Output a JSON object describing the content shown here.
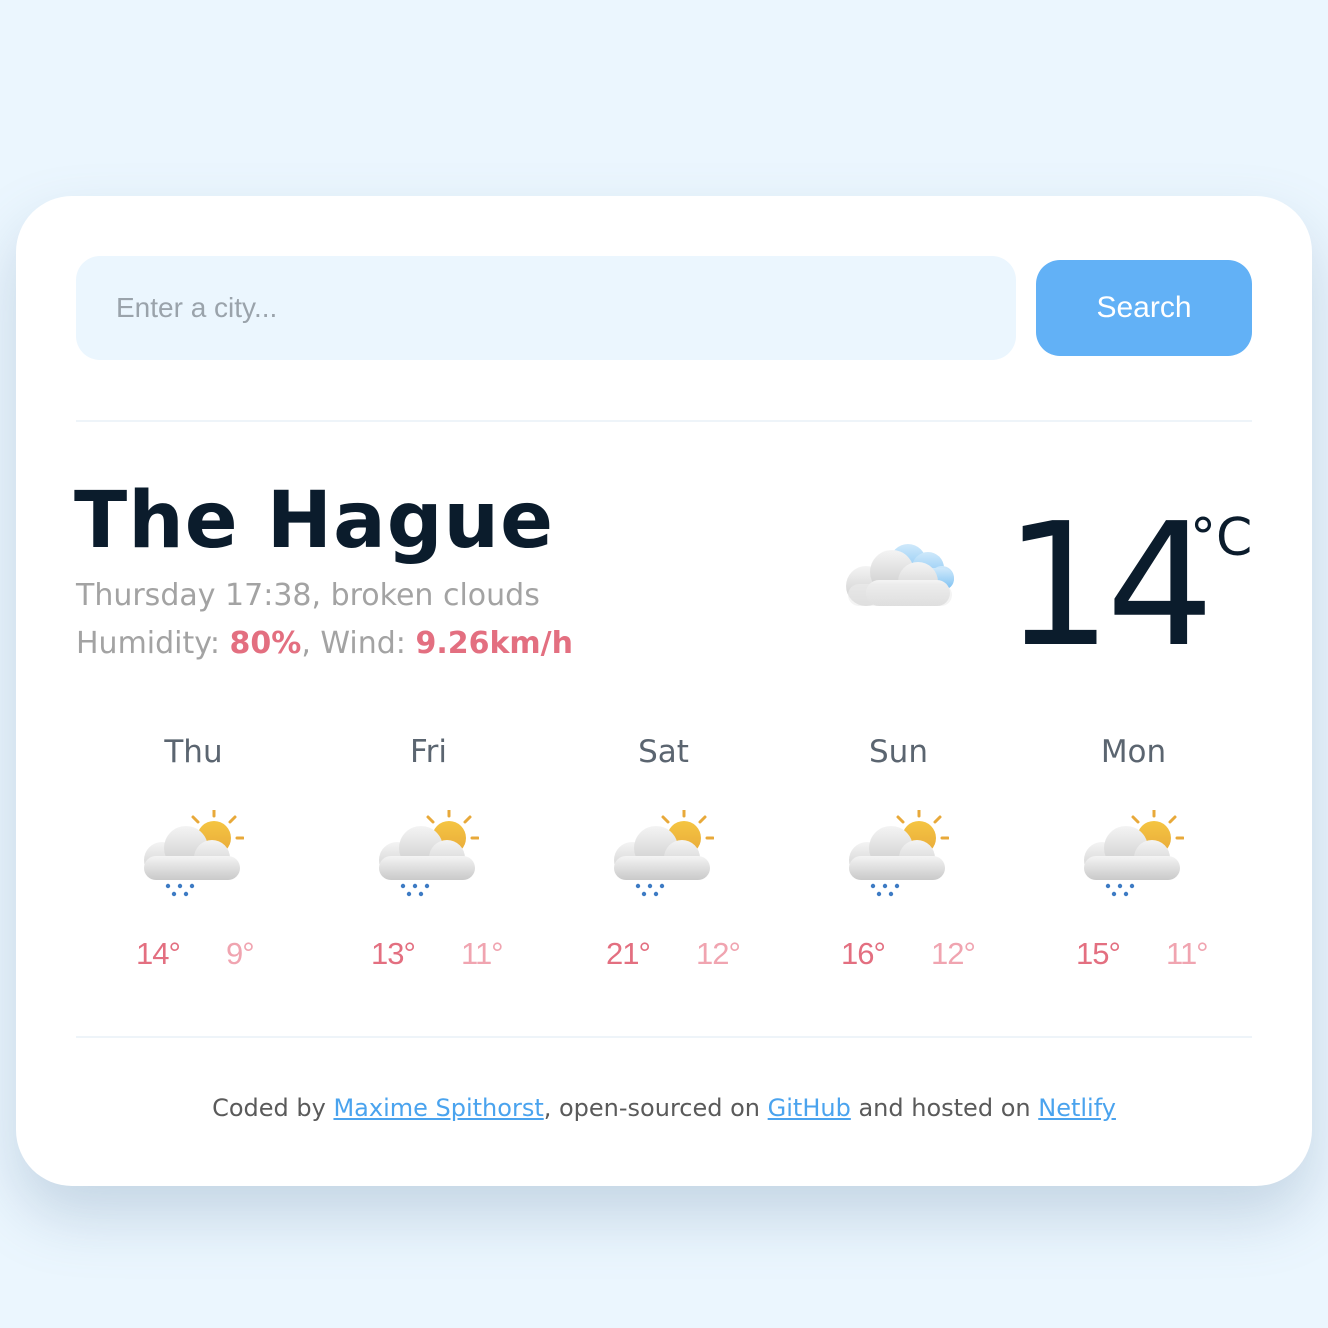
{
  "search": {
    "placeholder": "Enter a city...",
    "button_label": "Search"
  },
  "current": {
    "city": "The Hague",
    "day_time": "Thursday 17:38",
    "description": "broken clouds",
    "humidity_label": "Humidity:",
    "humidity_value": "80%",
    "wind_label": "Wind:",
    "wind_value": "9.26km/h",
    "temperature": "14",
    "unit": "°C",
    "icon": "broken-clouds-icon"
  },
  "forecast": [
    {
      "day": "Thu",
      "max": "14°",
      "min": "9°",
      "icon": "sun-cloud-rain-icon"
    },
    {
      "day": "Fri",
      "max": "13°",
      "min": "11°",
      "icon": "sun-cloud-rain-icon"
    },
    {
      "day": "Sat",
      "max": "21°",
      "min": "12°",
      "icon": "sun-cloud-rain-icon"
    },
    {
      "day": "Sun",
      "max": "16°",
      "min": "12°",
      "icon": "sun-cloud-rain-icon"
    },
    {
      "day": "Mon",
      "max": "15°",
      "min": "11°",
      "icon": "sun-cloud-rain-icon"
    }
  ],
  "footer": {
    "prefix": "Coded by",
    "author": "Maxime Spithorst",
    "middle": ", open-sourced on",
    "github": "GitHub",
    "middle2": "and hosted on",
    "netlify": "Netlify"
  },
  "colors": {
    "background": "#ebf6fe",
    "accent_blue": "#62b1f6",
    "max_temp": "#e36f80",
    "min_temp": "#f0a4b0",
    "text_dark": "#0b1c2c"
  }
}
